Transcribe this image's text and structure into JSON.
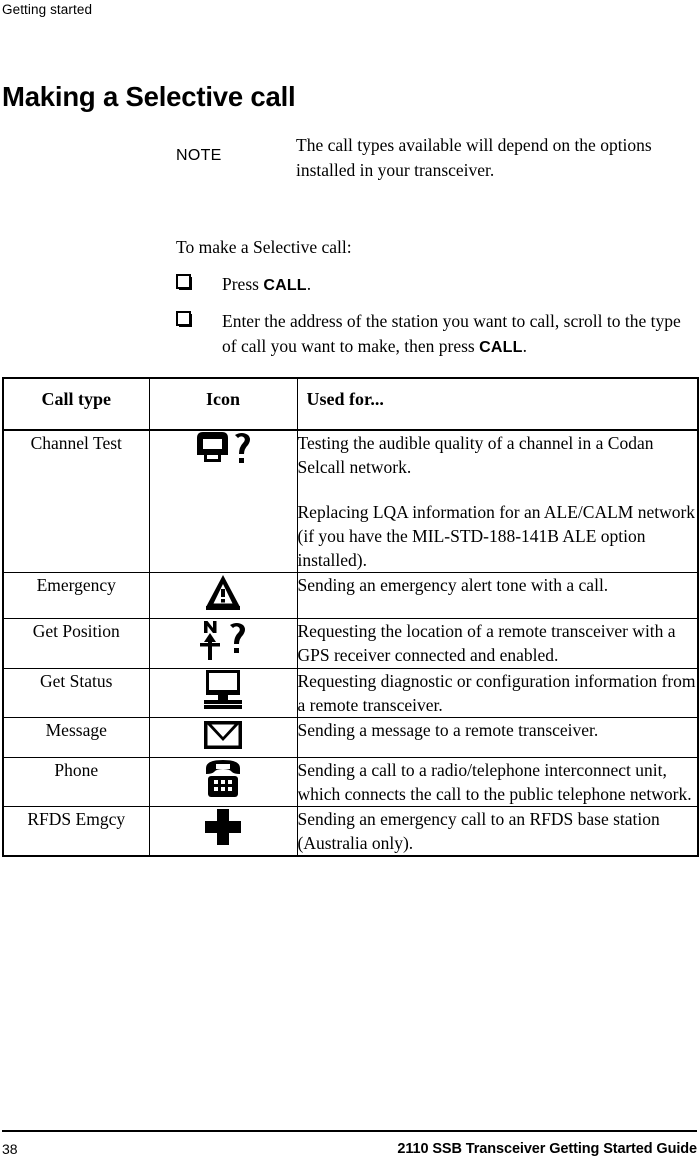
{
  "header": {
    "running_head": "Getting started"
  },
  "title": "Making a Selective call",
  "note": {
    "label": "NOTE",
    "text": "The call types available will depend on the options installed in your transceiver."
  },
  "intro": "To make a Selective call:",
  "steps": [
    {
      "bullet_icon": "square-bullet-icon",
      "text_before": "Press ",
      "key": "CALL",
      "text_after": "."
    },
    {
      "bullet_icon": "square-bullet-icon",
      "text_before": "Enter the address of the station you want to call, scroll to the type of call you want to make, then press ",
      "key": "CALL",
      "text_after": "."
    }
  ],
  "table": {
    "columns": [
      "Call type",
      "Icon",
      "Used for..."
    ],
    "rows": [
      {
        "call_type": "Channel Test",
        "icon": "transceiver-question-icon",
        "used_for": [
          "Testing the audible quality of a channel in a Codan Selcall network.",
          "Replacing LQA information for an ALE/CALM network (if you have the MIL-STD-188-141B ALE option installed)."
        ]
      },
      {
        "call_type": "Emergency",
        "icon": "warning-triangle-icon",
        "used_for": [
          "Sending an emergency alert tone with a call."
        ]
      },
      {
        "call_type": "Get Position",
        "icon": "compass-north-question-icon",
        "used_for": [
          "Requesting the location of a remote transceiver with a GPS receiver connected and enabled."
        ]
      },
      {
        "call_type": "Get Status",
        "icon": "computer-monitor-icon",
        "used_for": [
          "Requesting diagnostic or configuration information from a remote transceiver."
        ]
      },
      {
        "call_type": "Message",
        "icon": "envelope-icon",
        "used_for": [
          "Sending a message to a remote transceiver."
        ]
      },
      {
        "call_type": "Phone",
        "icon": "telephone-icon",
        "used_for": [
          "Sending a call to a radio/telephone interconnect unit, which connects the call to the public telephone network."
        ]
      },
      {
        "call_type": "RFDS Emgcy",
        "icon": "medical-cross-icon",
        "used_for": [
          "Sending an emergency call to an RFDS base station (Australia only)."
        ]
      }
    ]
  },
  "footer": {
    "page_number": "38",
    "guide_title": "2110 SSB Transceiver Getting Started Guide"
  },
  "colors": {
    "text": "#000000",
    "background": "#ffffff",
    "rule": "#000000"
  }
}
